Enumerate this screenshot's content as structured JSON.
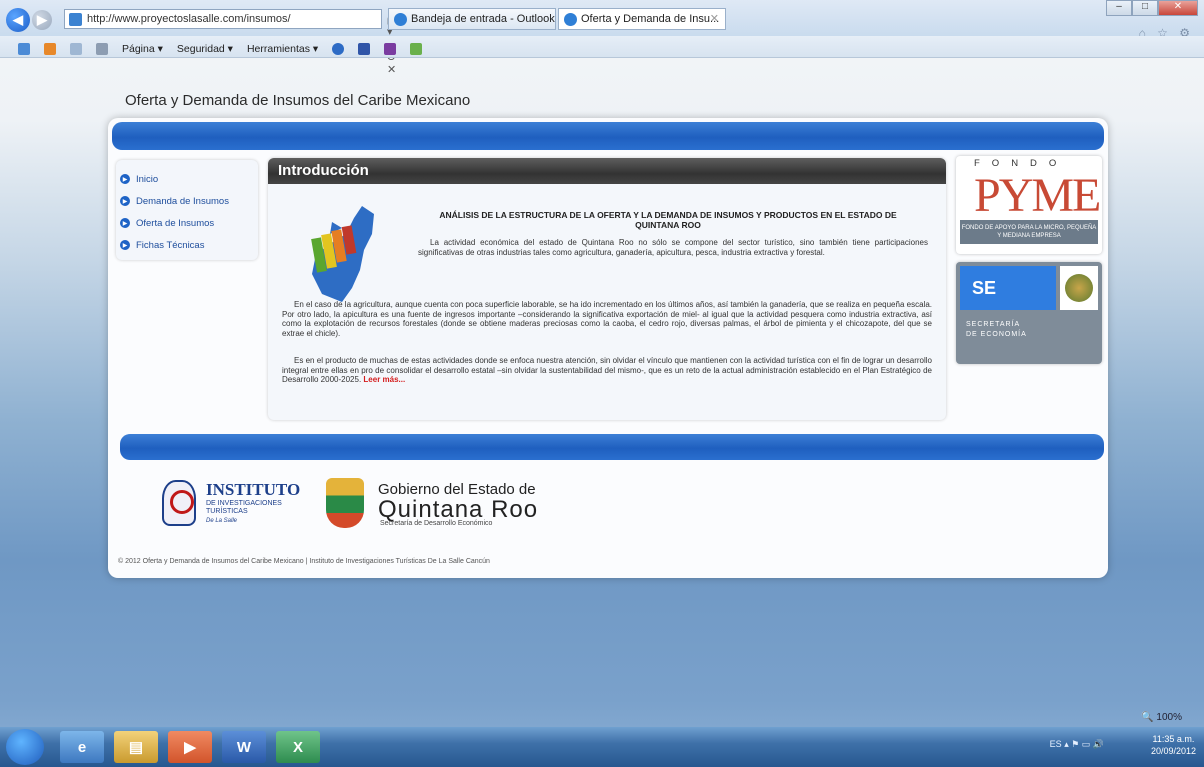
{
  "browser": {
    "address": "http://www.proyectoslasalle.com/insumos/",
    "address_tools": "ρ ▾ ⊠ C ✕",
    "tabs": [
      {
        "label": "Bandeja de entrada - Outlook ..."
      },
      {
        "label": "Oferta y Demanda de Insu...",
        "close": "✕"
      }
    ],
    "window_controls": {
      "minimize": "–",
      "maximize": "□",
      "close": "✕"
    },
    "toolbar_icons_right": "⌂ ☆ ⚙",
    "commands": [
      "Página ▾",
      "Seguridad ▾",
      "Herramientas ▾"
    ]
  },
  "page": {
    "site_title": "Oferta y Demanda de Insumos del Caribe Mexicano",
    "menu": [
      "Inicio",
      "Demanda de Insumos",
      "Oferta de Insumos",
      "Fichas Técnicas"
    ],
    "main_heading": "Introducción",
    "intro_title": "ANÁLISIS DE LA ESTRUCTURA DE LA OFERTA Y LA DEMANDA DE INSUMOS Y PRODUCTOS EN EL ESTADO DE QUINTANA ROO",
    "paragraph1": "La actividad económica del estado de Quintana Roo no sólo se compone del sector turístico, sino también tiene participaciones significativas de otras industrias tales como agricultura, ganadería, apicultura, pesca, industria extractiva y forestal.",
    "paragraph2": "En el caso de la agricultura, aunque cuenta con poca superficie laborable, se ha ido incrementado en los últimos años, así también la ganadería, que se realiza en pequeña escala. Por otro lado, la apicultura es una fuente de ingresos importante –considerando la significativa exportación de miel- al igual que la actividad pesquera como industria extractiva, así como la explotación de recursos forestales (donde se obtiene maderas preciosas como la caoba, el cedro rojo, diversas palmas, el árbol de pimienta y el chicozapote, del que se extrae el chicle).",
    "paragraph3": "Es en el producto de muchas de estas actividades donde se enfoca nuestra atención, sin olvidar el vínculo que mantienen con la actividad turística con el fin de lograr un desarrollo integral entre ellas en pro de consolidar el desarrollo estatal –sin olvidar la sustentabilidad del mismo-, que es un reto de la actual administración establecido en el Plan Estratégico de Desarrollo 2000-2025.",
    "read_more": "Leer más...",
    "pyme": {
      "fondo": "FONDO",
      "logo": "PYME",
      "band": "FONDO DE APOYO PARA LA MICRO, PEQUEÑA Y MEDIANA EMPRESA"
    },
    "se": {
      "abbr": "SE",
      "name_line1": "SECRETARÍA",
      "name_line2": "DE ECONOMÍA"
    },
    "footer": {
      "inst_title": "INSTITUTO",
      "inst_sub1": "DE INVESTIGACIONES",
      "inst_sub2": "TURÍSTICAS",
      "inst_sub3": "De La Salle",
      "gob_line1": "Gobierno del Estado de",
      "gob_line2": "Quintana Roo",
      "gob_line3": "Secretaría de Desarrollo Económico",
      "copyright": "© 2012 Oferta y Demanda de Insumos del Caribe Mexicano | Instituto de Investigaciones Turísticas De La Salle Cancún"
    }
  },
  "status": {
    "zoom": "100%",
    "lang": "ES",
    "time": "11:35 a.m.",
    "date": "20/09/2012"
  },
  "colors": {
    "accent_blue": "#1f5fbf",
    "heading_dark": "#333333",
    "read_more": "#d41c1c",
    "pyme_red": "#c84a35"
  }
}
